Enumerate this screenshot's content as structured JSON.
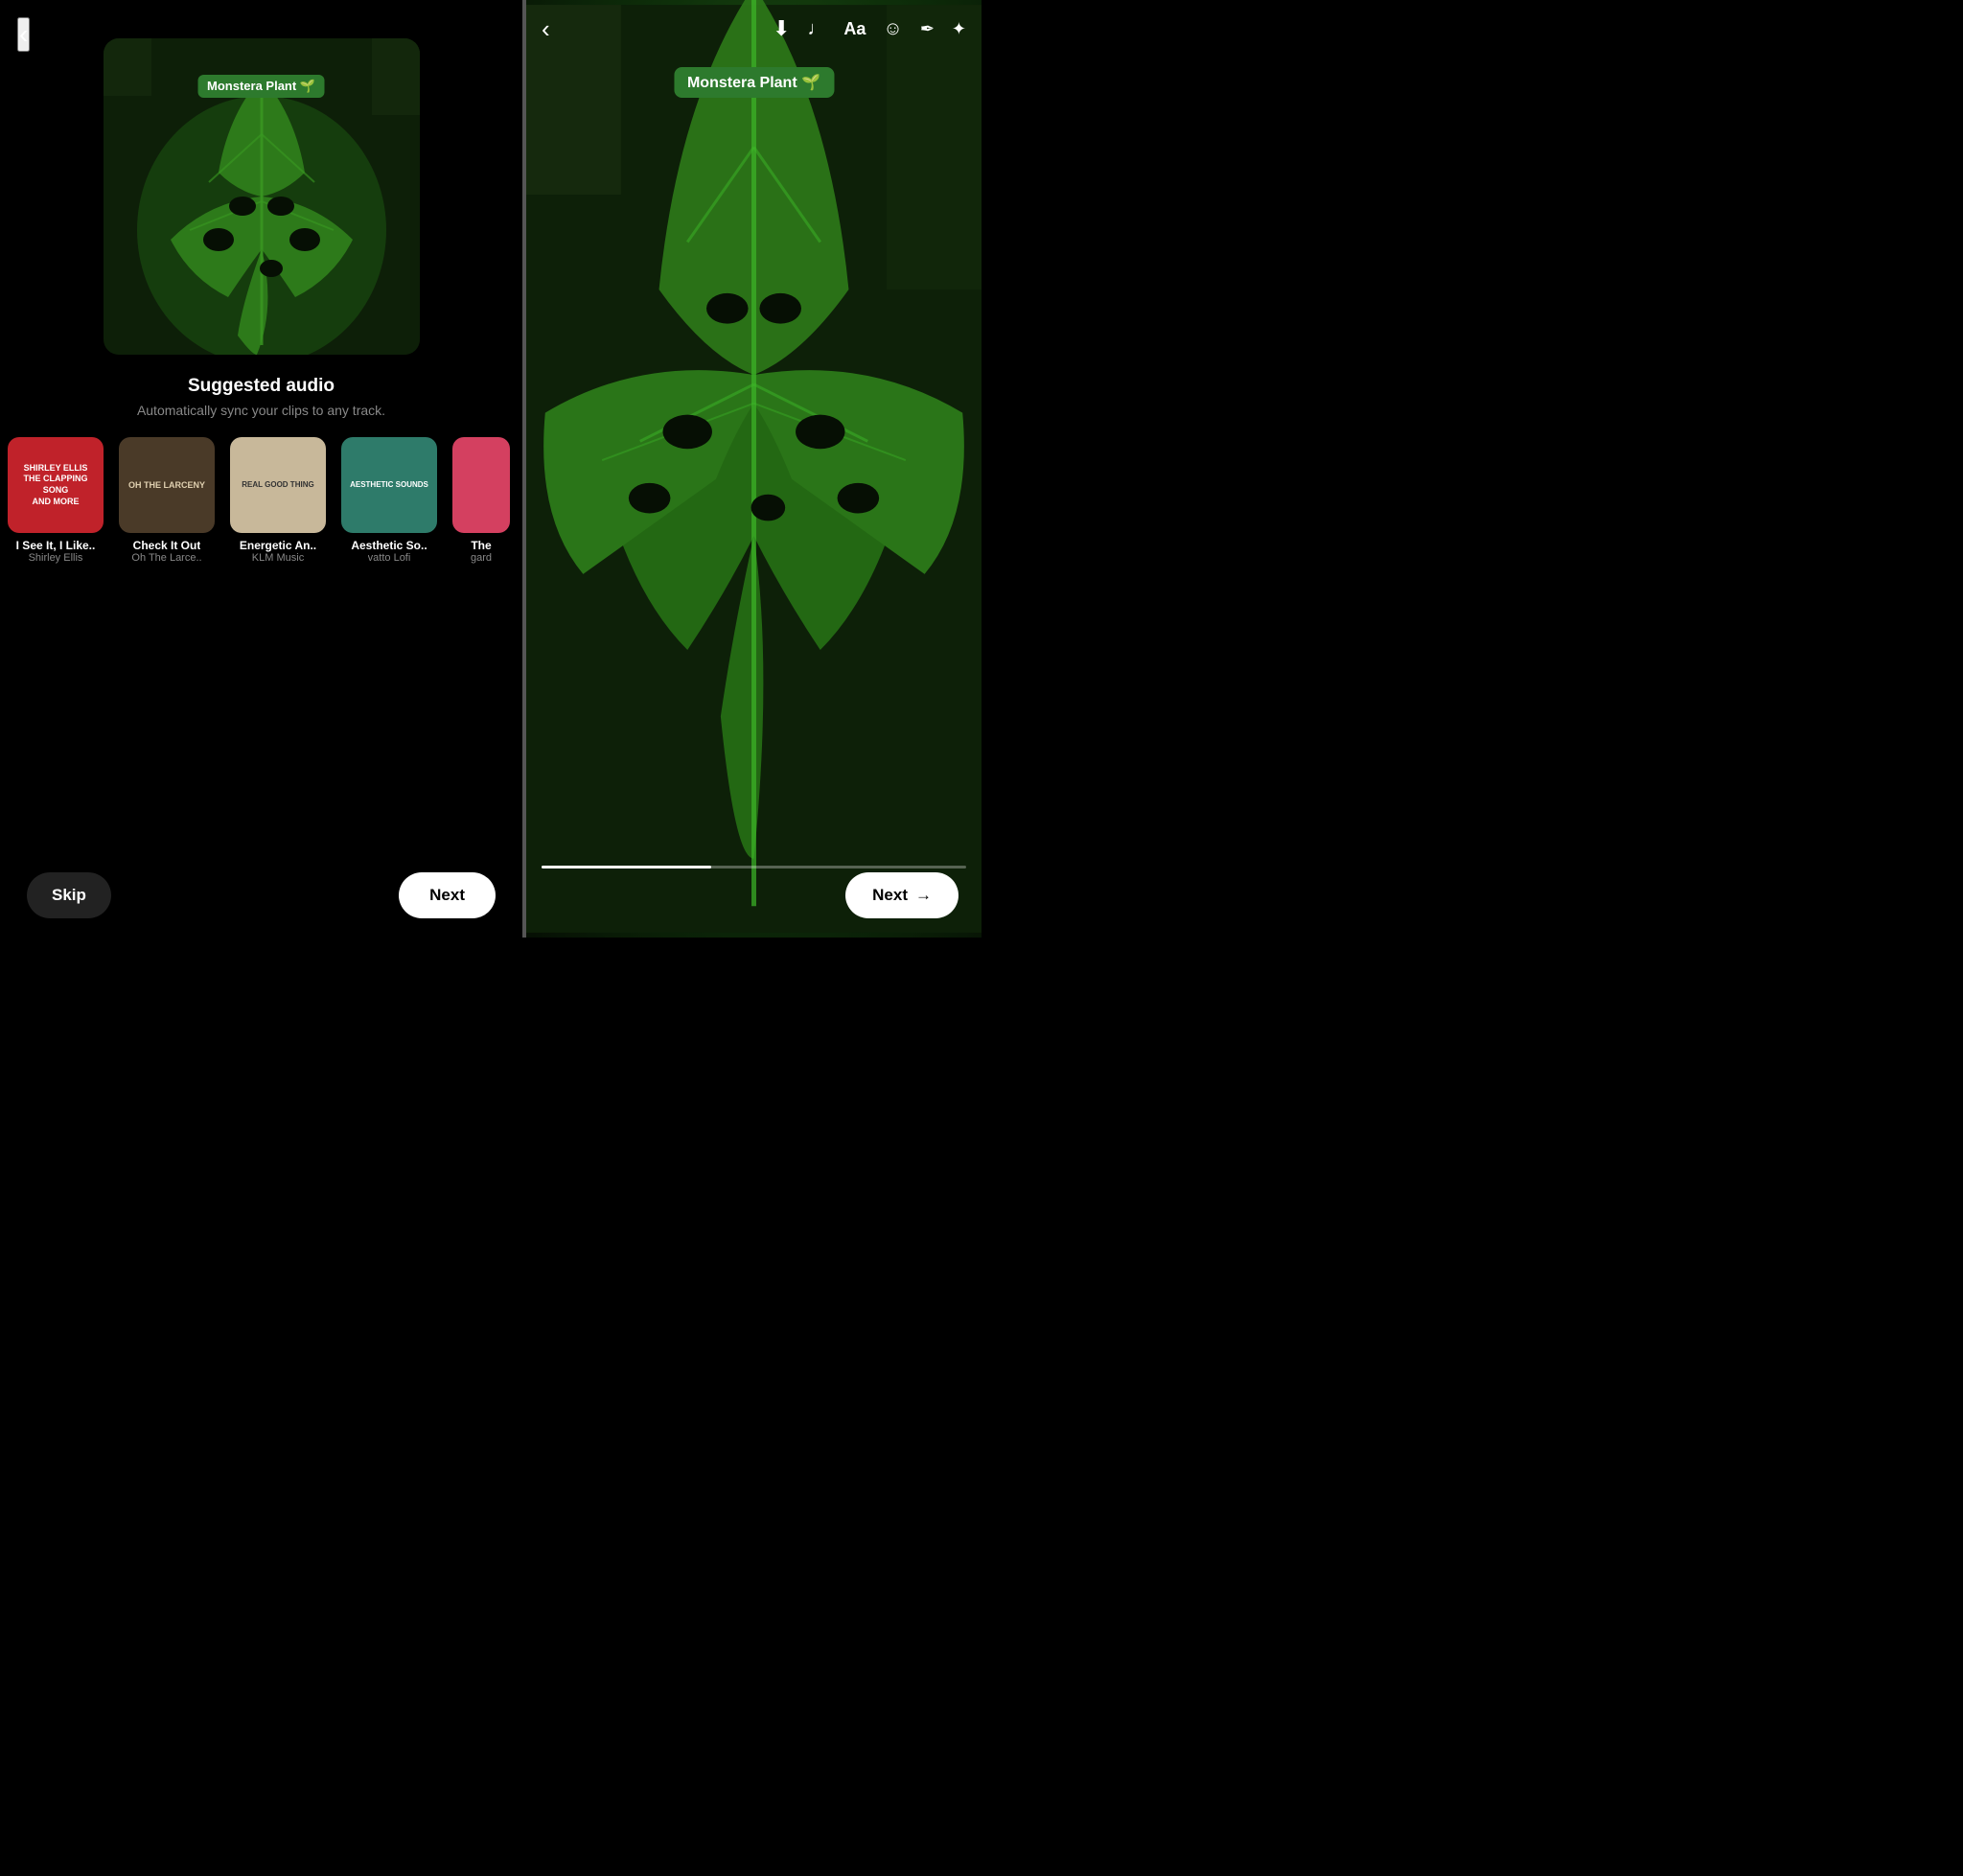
{
  "leftPanel": {
    "backIcon": "‹",
    "previewLabel": "Monstera Plant 🌱",
    "suggestedAudio": {
      "title": "Suggested audio",
      "subtitle": "Automatically sync your clips to any track."
    },
    "tracks": [
      {
        "id": 1,
        "name": "I See It, I Like..",
        "artist": "Shirley Ellis",
        "bgClass": "track-thumb-1",
        "thumbText": "SHIRLEY ELLIS\nTHE CLAPPING SONG\nAND MORE"
      },
      {
        "id": 2,
        "name": "Check It Out",
        "artist": "Oh The Larce..",
        "bgClass": "track-thumb-2",
        "thumbText": "OH THE LARCENY"
      },
      {
        "id": 3,
        "name": "Energetic An..",
        "artist": "KLM Music",
        "bgClass": "track-thumb-3",
        "thumbText": "REAL GOOD THING"
      },
      {
        "id": 4,
        "name": "Aesthetic So..",
        "artist": "vatto Lofi",
        "bgClass": "track-thumb-4",
        "thumbText": "AESTHETIC SOUNDS"
      },
      {
        "id": 5,
        "name": "The",
        "artist": "gard",
        "bgClass": "track-thumb-5",
        "thumbText": ""
      }
    ],
    "skipLabel": "Skip",
    "nextLabel": "Next"
  },
  "rightPanel": {
    "backIcon": "‹",
    "downloadIcon": "⬇",
    "musicIcon": "♪",
    "textIcon": "Aa",
    "stickerIcon": "☺",
    "brushIcon": "✏",
    "sparkleIcon": "✦",
    "label": "Monstera Plant 🌱",
    "nextLabel": "Next",
    "nextArrow": "→"
  }
}
